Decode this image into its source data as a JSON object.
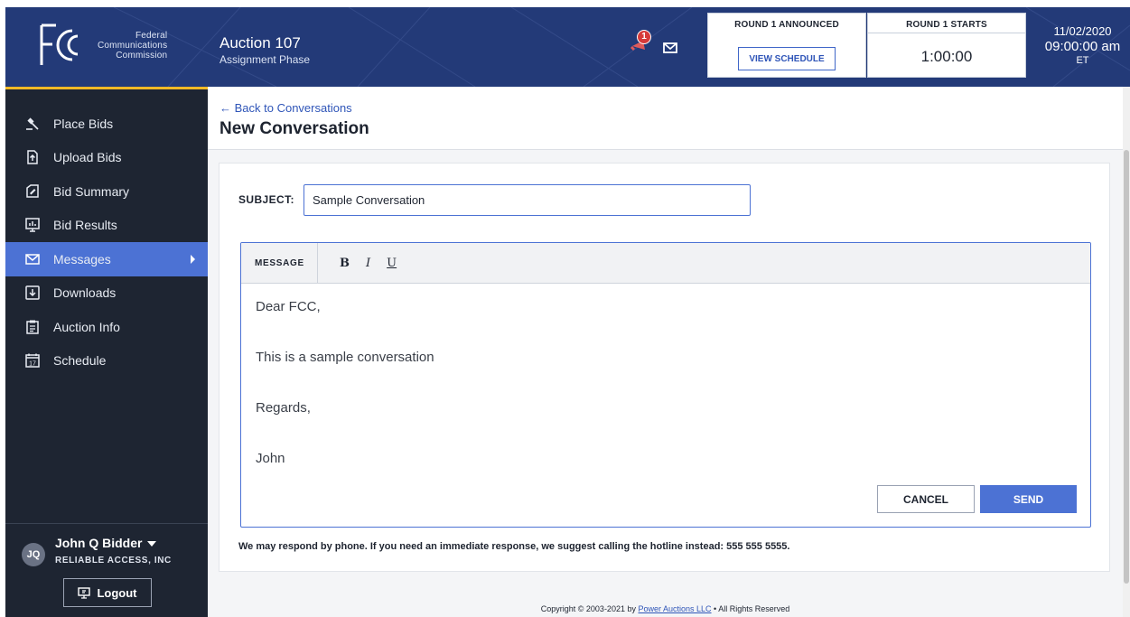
{
  "header": {
    "org_name": [
      "Federal",
      "Communications",
      "Commission"
    ],
    "auction_title": "Auction 107",
    "auction_phase": "Assignment Phase",
    "notification_count": "1",
    "round_announced_label": "ROUND 1 ANNOUNCED",
    "view_schedule_label": "VIEW SCHEDULE",
    "round_starts_label": "ROUND 1 STARTS",
    "round_starts_time": "1:00:00",
    "date": "11/02/2020",
    "time": "09:00:00 am",
    "timezone": "ET"
  },
  "sidebar": {
    "items": [
      {
        "label": "Place Bids",
        "icon": "gavel-icon"
      },
      {
        "label": "Upload Bids",
        "icon": "upload-icon"
      },
      {
        "label": "Bid Summary",
        "icon": "summary-icon"
      },
      {
        "label": "Bid Results",
        "icon": "results-icon"
      },
      {
        "label": "Messages",
        "icon": "envelope-icon",
        "active": true
      },
      {
        "label": "Downloads",
        "icon": "download-icon"
      },
      {
        "label": "Auction Info",
        "icon": "clipboard-icon"
      },
      {
        "label": "Schedule",
        "icon": "calendar-icon"
      }
    ],
    "user": {
      "initials": "JQ",
      "name": "John Q Bidder",
      "org": "RELIABLE ACCESS, INC",
      "logout_label": "Logout"
    }
  },
  "page": {
    "back_link": "← Back to Conversations",
    "title": "New Conversation",
    "subject_label": "SUBJECT:",
    "subject_value": "Sample Conversation",
    "message_label": "MESSAGE",
    "toolbar": {
      "bold": "B",
      "italic": "I",
      "underline": "U"
    },
    "message_lines": [
      "Dear FCC,",
      "This is a sample conversation",
      "Regards,",
      "John"
    ],
    "cancel_label": "CANCEL",
    "send_label": "SEND",
    "note": "We may respond by phone. If you need an immediate response, we suggest calling the hotline instead: 555 555 5555.",
    "footer_prefix": "Copyright © 2003-2021 by",
    "footer_link": "Power Auctions LLC",
    "footer_suffix": "• All Rights Reserved"
  },
  "colors": {
    "header_bg": "#233a78",
    "sidebar_bg": "#1e2532",
    "accent": "#4c72d4",
    "sidebar_accent": "#f2b927",
    "badge": "#d63a3a"
  }
}
